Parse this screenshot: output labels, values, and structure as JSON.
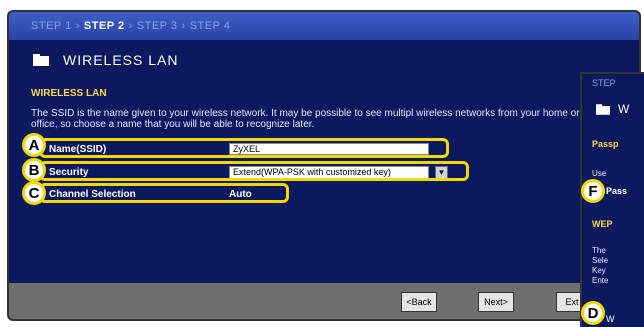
{
  "steps": {
    "step1": "STEP 1",
    "step2": "STEP 2",
    "step3": "STEP 3",
    "step4": "STEP 4",
    "separator": "›"
  },
  "title": "WIRELESS LAN",
  "section_heading": "WIRELESS LAN",
  "description": "The SSID is the name given to your wireless network. It may be possible to see multipl wireless networks from your home or office, so choose a name that you will be able to recognize later.",
  "fields": {
    "ssid_label": "Name(SSID)",
    "ssid_value": "ZyXEL",
    "security_label": "Security",
    "security_value": "Extend(WPA-PSK with customized key)",
    "channel_label": "Channel Selection",
    "channel_value": "Auto"
  },
  "markers": {
    "a": "A",
    "b": "B",
    "c": "C",
    "d": "D",
    "f": "F"
  },
  "buttons": {
    "back": "<Back",
    "next": "Next>",
    "exit": "Ext"
  },
  "right_panel": {
    "step_text": "STEP",
    "title_fragment": "W",
    "pass_heading": "Passp",
    "use_text": "Use",
    "pass_label": "Pass",
    "wep_heading": "WEP",
    "line1": "The",
    "line2": "Sele",
    "line3": "Key",
    "line4": "Ente",
    "bottom_text": "W"
  },
  "colors": {
    "background": "#0b1a5e",
    "steps_bar": "#2a44a8",
    "highlight": "#f5d800",
    "section": "#ffd84a",
    "footer": "#6f6f6f"
  }
}
